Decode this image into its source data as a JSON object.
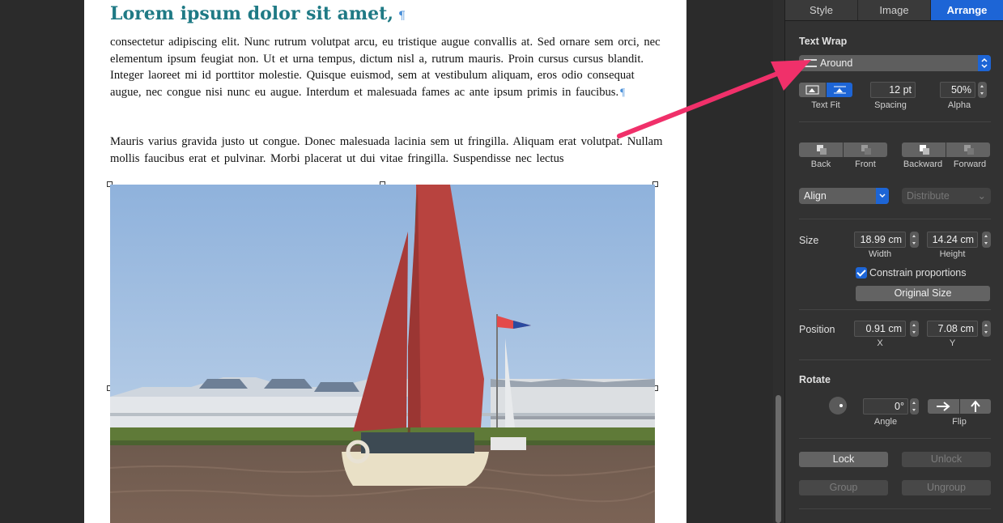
{
  "document": {
    "heading": "Lorem ipsum dolor sit amet,",
    "pilcrow": "¶",
    "paragraph1": "consectetur adipiscing elit. Nunc rutrum volutpat arcu, eu tristique augue convallis at. Sed ornare sem orci, nec elementum ipsum feugiat non. Ut et urna tempus, dictum nisl a, rutrum mauris. Proin cursus cursus blandit. Integer laoreet mi id porttitor molestie. Quisque euismod, sem at vestibulum aliquam, eros odio consequat augue, nec congue nisi nunc eu augue. Interdum et malesuada fames ac ante ipsum primis in faucibus.",
    "paragraph2": "Mauris varius gravida justo ut congue. Donec malesuada lacinia sem ut fringilla. Aliquam erat volutpat. Nullam mollis faucibus erat et pulvinar. Morbi placerat ut dui vitae fringilla. Suspendisse nec lectus"
  },
  "inspector": {
    "tabs": [
      "Style",
      "Image",
      "Arrange"
    ],
    "active_tab": "Arrange",
    "text_wrap": {
      "label": "Text Wrap",
      "value": "Around",
      "text_fit_label": "Text Fit",
      "spacing_value": "12 pt",
      "spacing_label": "Spacing",
      "alpha_value": "50%",
      "alpha_label": "Alpha"
    },
    "layering": {
      "back": "Back",
      "front": "Front",
      "backward": "Backward",
      "forward": "Forward"
    },
    "align": {
      "align_label": "Align",
      "distribute_label": "Distribute"
    },
    "size": {
      "label": "Size",
      "width_value": "18.99 cm",
      "width_label": "Width",
      "height_value": "14.24 cm",
      "height_label": "Height",
      "constrain_label": "Constrain proportions",
      "original_size_label": "Original Size"
    },
    "position": {
      "label": "Position",
      "x_value": "0.91 cm",
      "x_label": "X",
      "y_value": "7.08 cm",
      "y_label": "Y"
    },
    "rotate": {
      "label": "Rotate",
      "angle_value": "0°",
      "angle_label": "Angle",
      "flip_label": "Flip"
    },
    "lock": {
      "lock": "Lock",
      "unlock": "Unlock",
      "group": "Group",
      "ungroup": "Ungroup"
    }
  },
  "colors": {
    "accent": "#1d65d6",
    "heading": "#1f7a85",
    "annotation_arrow": "#f0306a"
  }
}
